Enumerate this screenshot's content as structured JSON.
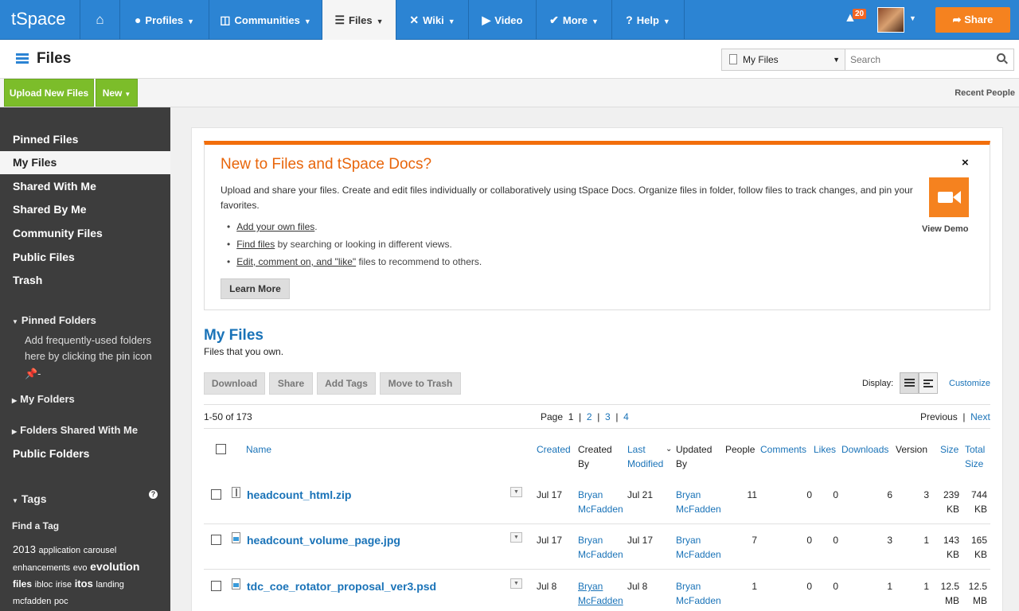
{
  "nav": {
    "brand": "tSpace",
    "items": [
      {
        "label": "",
        "icon": "home-icon"
      },
      {
        "label": "Profiles",
        "icon": "person-icon"
      },
      {
        "label": "Communities",
        "icon": "communities-icon"
      },
      {
        "label": "Files",
        "icon": "files-icon"
      },
      {
        "label": "Wiki",
        "icon": "wiki-icon"
      },
      {
        "label": "Video",
        "icon": "video-icon"
      },
      {
        "label": "More",
        "icon": "more-icon"
      },
      {
        "label": "Help",
        "icon": "help-icon"
      }
    ],
    "notification_count": "20",
    "share_label": "Share"
  },
  "titlebar": {
    "title": "Files",
    "scope_value": "My Files",
    "search_placeholder": "Search"
  },
  "actions": {
    "upload_label": "Upload New Files",
    "new_label": "New",
    "recent_people": "Recent People"
  },
  "sidebar": {
    "items": [
      "Pinned Files",
      "My Files",
      "Shared With Me",
      "Shared By Me",
      "Community Files",
      "Public Files",
      "Trash"
    ],
    "pinned_folders": "Pinned Folders",
    "pinned_hint": "Add frequently-used folders here by clicking the pin icon",
    "my_folders": "My Folders",
    "folders_shared": "Folders Shared With Me",
    "public_folders": "Public Folders",
    "tags_title": "Tags",
    "find_tag": "Find a Tag",
    "tags": [
      "2013",
      "application",
      "carousel",
      "enhancements",
      "evo",
      "evolution",
      "files",
      "ibloc",
      "irise",
      "itos",
      "landing",
      "mcfadden",
      "poc"
    ]
  },
  "banner": {
    "title": "New to Files and tSpace Docs?",
    "description": "Upload and share your files. Create and edit files individually or collaboratively using tSpace Docs. Organize files in folder, follow files to track changes, and pin your favorites.",
    "bullets": [
      {
        "link": "Add your own files",
        "rest": "."
      },
      {
        "link": "Find files",
        "rest": " by searching or looking in different views."
      },
      {
        "link": "Edit, comment on, and \"like\"",
        "rest": " files to recommend to others."
      }
    ],
    "learn_more": "Learn More",
    "close": "×",
    "view_demo": "View Demo"
  },
  "files": {
    "title": "My Files",
    "subtitle": "Files that you own.",
    "buttons": {
      "download": "Download",
      "share": "Share",
      "add_tags": "Add Tags",
      "move_trash": "Move to Trash"
    },
    "display_label": "Display:",
    "customize": "Customize",
    "range": "1-50 of 173",
    "page_label": "Page",
    "pages": [
      "1",
      "2",
      "3",
      "4"
    ],
    "previous": "Previous",
    "next": "Next",
    "columns": {
      "name": "Name",
      "created": "Created",
      "created_by_1": "Created",
      "created_by_2": "By",
      "last_modified_1": "Last",
      "last_modified_2": "Modified",
      "updated_by_1": "Updated",
      "updated_by_2": "By",
      "people": "People",
      "comments": "Comments",
      "likes": "Likes",
      "downloads": "Downloads",
      "version": "Version",
      "size": "Size",
      "total_size_1": "Total",
      "total_size_2": "Size"
    },
    "rows": [
      {
        "name": "headcount_html.zip",
        "type": "zip",
        "created": "Jul 17",
        "created_by_1": "Bryan",
        "created_by_2": "McFadden",
        "modified": "Jul 21",
        "updated_by_1": "Bryan",
        "updated_by_2": "McFadden",
        "people": "11",
        "comments": "0",
        "likes": "0",
        "downloads": "6",
        "version": "3",
        "size_1": "239",
        "size_2": "KB",
        "total_1": "744",
        "total_2": "KB"
      },
      {
        "name": "headcount_volume_page.jpg",
        "type": "img",
        "created": "Jul 17",
        "created_by_1": "Bryan",
        "created_by_2": "McFadden",
        "modified": "Jul 17",
        "updated_by_1": "Bryan",
        "updated_by_2": "McFadden",
        "people": "7",
        "comments": "0",
        "likes": "0",
        "downloads": "3",
        "version": "1",
        "size_1": "143",
        "size_2": "KB",
        "total_1": "165",
        "total_2": "KB"
      },
      {
        "name": "tdc_coe_rotator_proposal_ver3.psd",
        "type": "img",
        "created": "Jul 8",
        "created_by_1": "Bryan",
        "created_by_2": "McFadden",
        "modified": "Jul 8",
        "updated_by_1": "Bryan",
        "updated_by_2": "McFadden",
        "people": "1",
        "comments": "0",
        "likes": "0",
        "downloads": "1",
        "version": "1",
        "size_1": "12.5",
        "size_2": "MB",
        "total_1": "12.5",
        "total_2": "MB"
      }
    ]
  },
  "colors": {
    "nav_blue": "#2c84d3",
    "accent_orange": "#f5821f",
    "green": "#7cbd2a",
    "link_blue": "#1a73b8"
  }
}
